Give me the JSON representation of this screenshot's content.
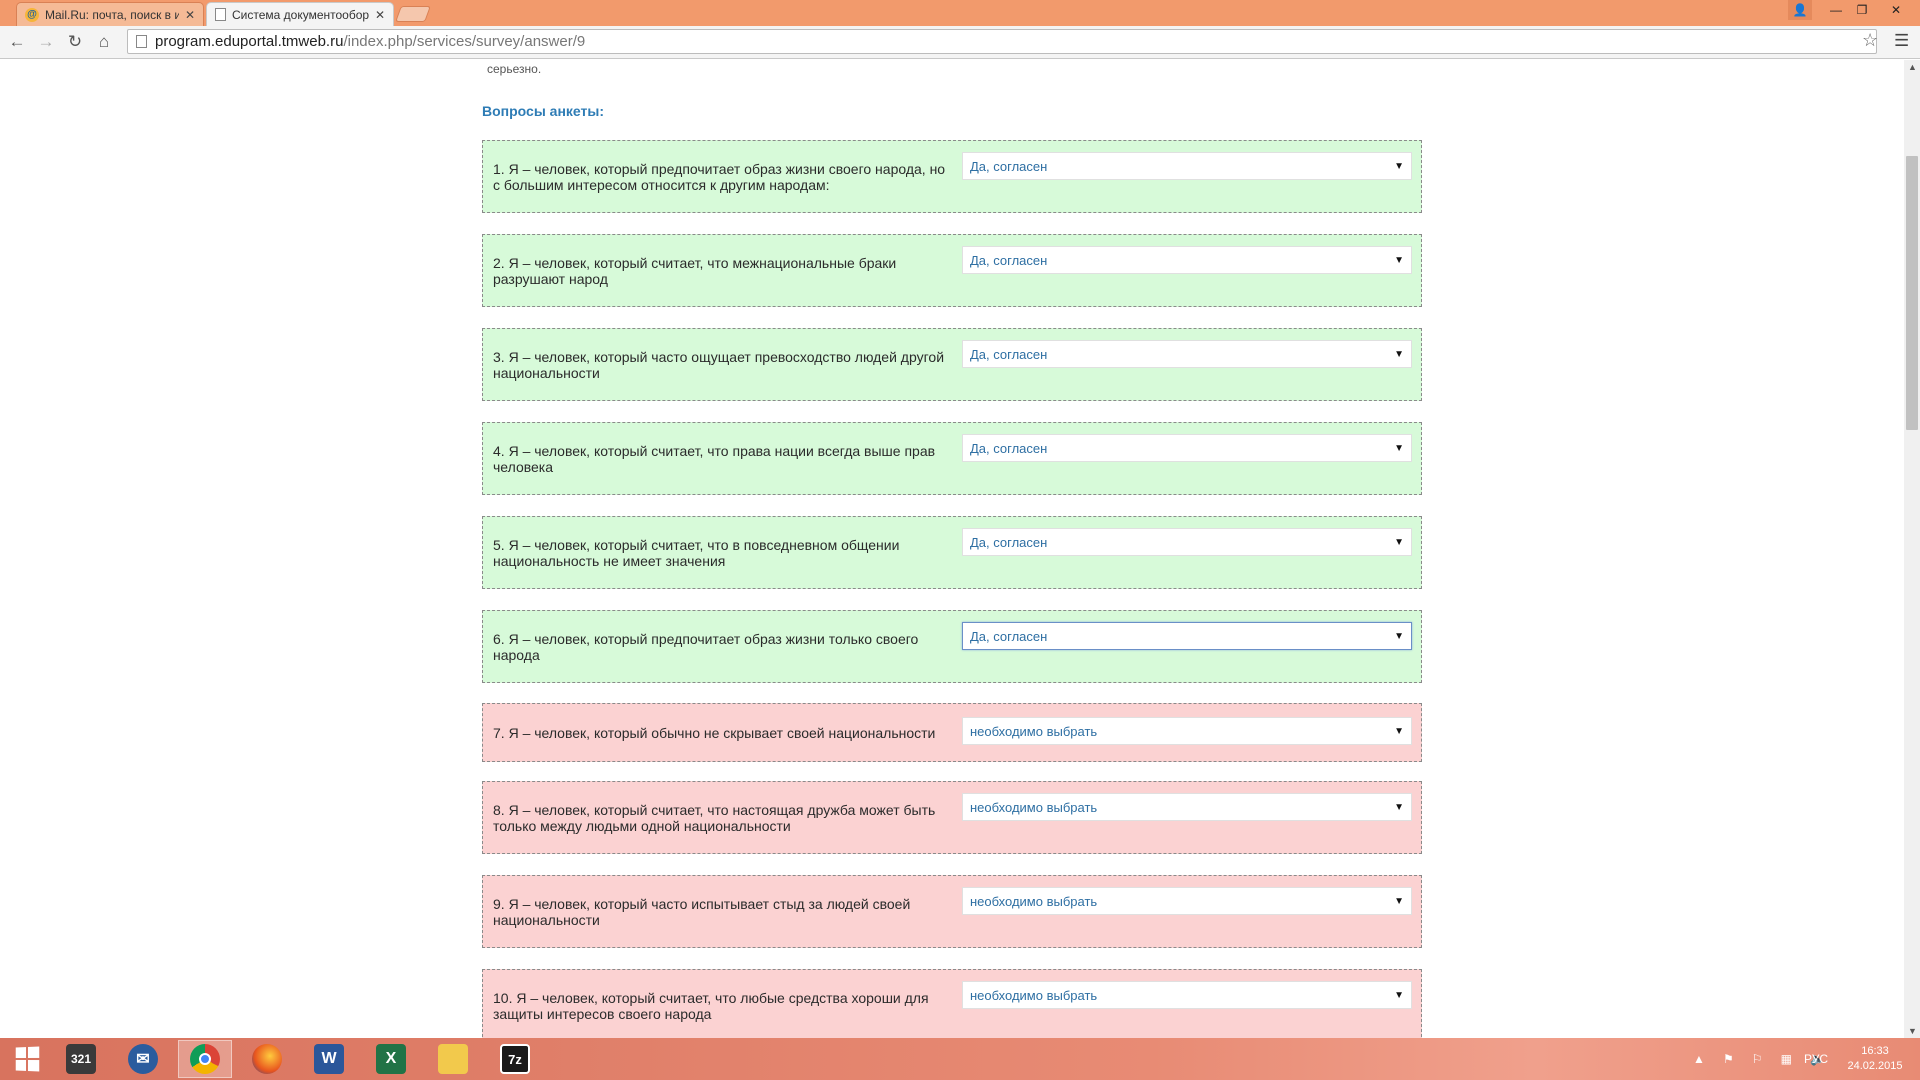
{
  "browser": {
    "tabs": [
      {
        "title": "Mail.Ru: почта, поиск в и",
        "icon": "mailru-icon",
        "active": false
      },
      {
        "title": "Система документообор",
        "icon": "page-icon",
        "active": true
      }
    ],
    "address": {
      "host": "program.eduportal.tmweb.ru",
      "path": "/index.php/services/survey/answer/9"
    }
  },
  "page": {
    "intro_tail": "серьезно.",
    "section_title": "Вопросы анкеты:",
    "questions": [
      {
        "text": "1. Я – человек, который предпочитает образ жизни своего народа, но с большим интересом относится к другим народам:",
        "answer": "Да, согласен",
        "status": "answered"
      },
      {
        "text": "2. Я – человек, который считает, что межнациональные браки разрушают народ",
        "answer": "Да, согласен",
        "status": "answered"
      },
      {
        "text": "3. Я – человек, который часто ощущает превосходство людей другой национальности",
        "answer": "Да, согласен",
        "status": "answered"
      },
      {
        "text": "4. Я – человек, который считает, что права нации всегда выше прав человека",
        "answer": "Да, согласен",
        "status": "answered"
      },
      {
        "text": "5. Я – человек, который считает, что в повседневном общении национальность не имеет значения",
        "answer": "Да, согласен",
        "status": "answered"
      },
      {
        "text": "6. Я – человек, который предпочитает образ жизни только своего народа",
        "answer": "Да, согласен",
        "status": "answered"
      },
      {
        "text": "7. Я – человек, который обычно не скрывает своей национальности",
        "answer": "необходимо выбрать",
        "status": "required"
      },
      {
        "text": "8. Я – человек, который считает, что настоящая дружба может быть только между людьми одной национальности",
        "answer": "необходимо выбрать",
        "status": "required"
      },
      {
        "text": "9. Я – человек, который часто испытывает стыд за людей своей национальности",
        "answer": "необходимо выбрать",
        "status": "required"
      },
      {
        "text": "10. Я – человек, который считает, что любые средства хороши для защиты интересов своего народа",
        "answer": "необходимо выбрать",
        "status": "required"
      }
    ]
  },
  "taskbar": {
    "apps": [
      "start-icon",
      "media-player-icon",
      "thunderbird-icon",
      "chrome-icon",
      "firefox-icon",
      "word-icon",
      "excel-icon",
      "file-explorer-icon",
      "7zip-icon"
    ],
    "language": "РУС",
    "time": "16:33",
    "date": "24.02.2015"
  },
  "colors": {
    "answered_bg": "#d7fad9",
    "required_bg": "#fbd2d2",
    "section_title": "#2e7cb5",
    "select_text": "#2e6fa3"
  }
}
